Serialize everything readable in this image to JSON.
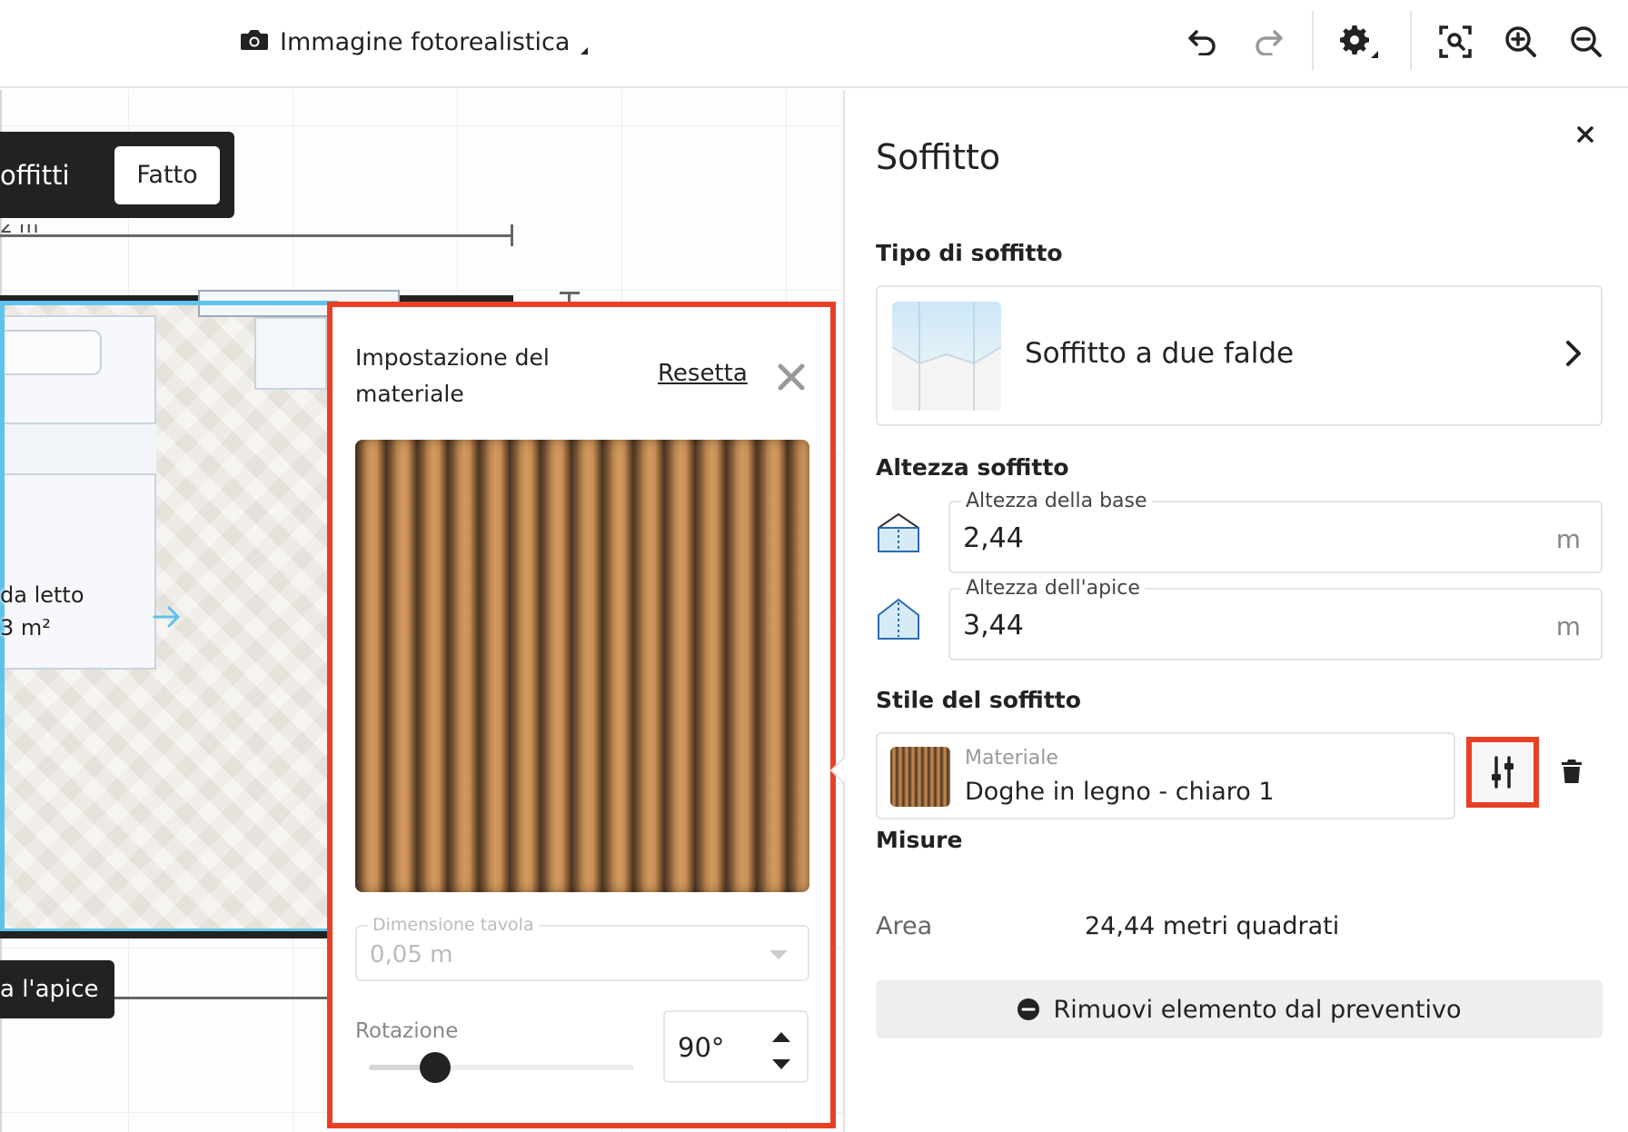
{
  "toolbar": {
    "render_mode_label": "Immagine fotorealistica",
    "icons": [
      "camera-icon",
      "undo-icon",
      "redo-icon",
      "settings-icon",
      "fit-view-icon",
      "zoom-in-icon",
      "zoom-out-icon"
    ]
  },
  "canvas": {
    "ceiling_tool_label": "offitti",
    "done_label": "Fatto",
    "room_name_fragment": "da letto",
    "room_area_fragment": "3 m²",
    "dimension_fragment": "2 m",
    "apex_pill_label": "a l'apice"
  },
  "material_popup": {
    "title": "Impostazione del materiale",
    "reset_label": "Resetta",
    "board_size": {
      "label": "Dimensione tavola",
      "value": "0,05 m"
    },
    "rotation": {
      "label": "Rotazione",
      "value": "90°",
      "slider_fraction": 0.25
    }
  },
  "panel": {
    "title": "Soffitto",
    "ceiling_type": {
      "section_label": "Tipo di soffitto",
      "value": "Soffitto a due falde"
    },
    "ceiling_height": {
      "section_label": "Altezza soffitto",
      "base": {
        "label": "Altezza della base",
        "value": "2,44",
        "unit": "m"
      },
      "apex": {
        "label": "Altezza dell'apice",
        "value": "3,44",
        "unit": "m"
      }
    },
    "ceiling_style": {
      "section_label": "Stile del soffitto",
      "material_label": "Materiale",
      "material_value": "Doghe in legno - chiaro 1"
    },
    "measures": {
      "section_label": "Misure",
      "area_label": "Area",
      "area_value": "24,44 metri quadrati"
    },
    "remove_label": "Rimuovi elemento dal preventivo"
  },
  "colors": {
    "accent_highlight": "#e84025",
    "selection_blue": "#5fc2ec",
    "text_primary": "#222222"
  }
}
